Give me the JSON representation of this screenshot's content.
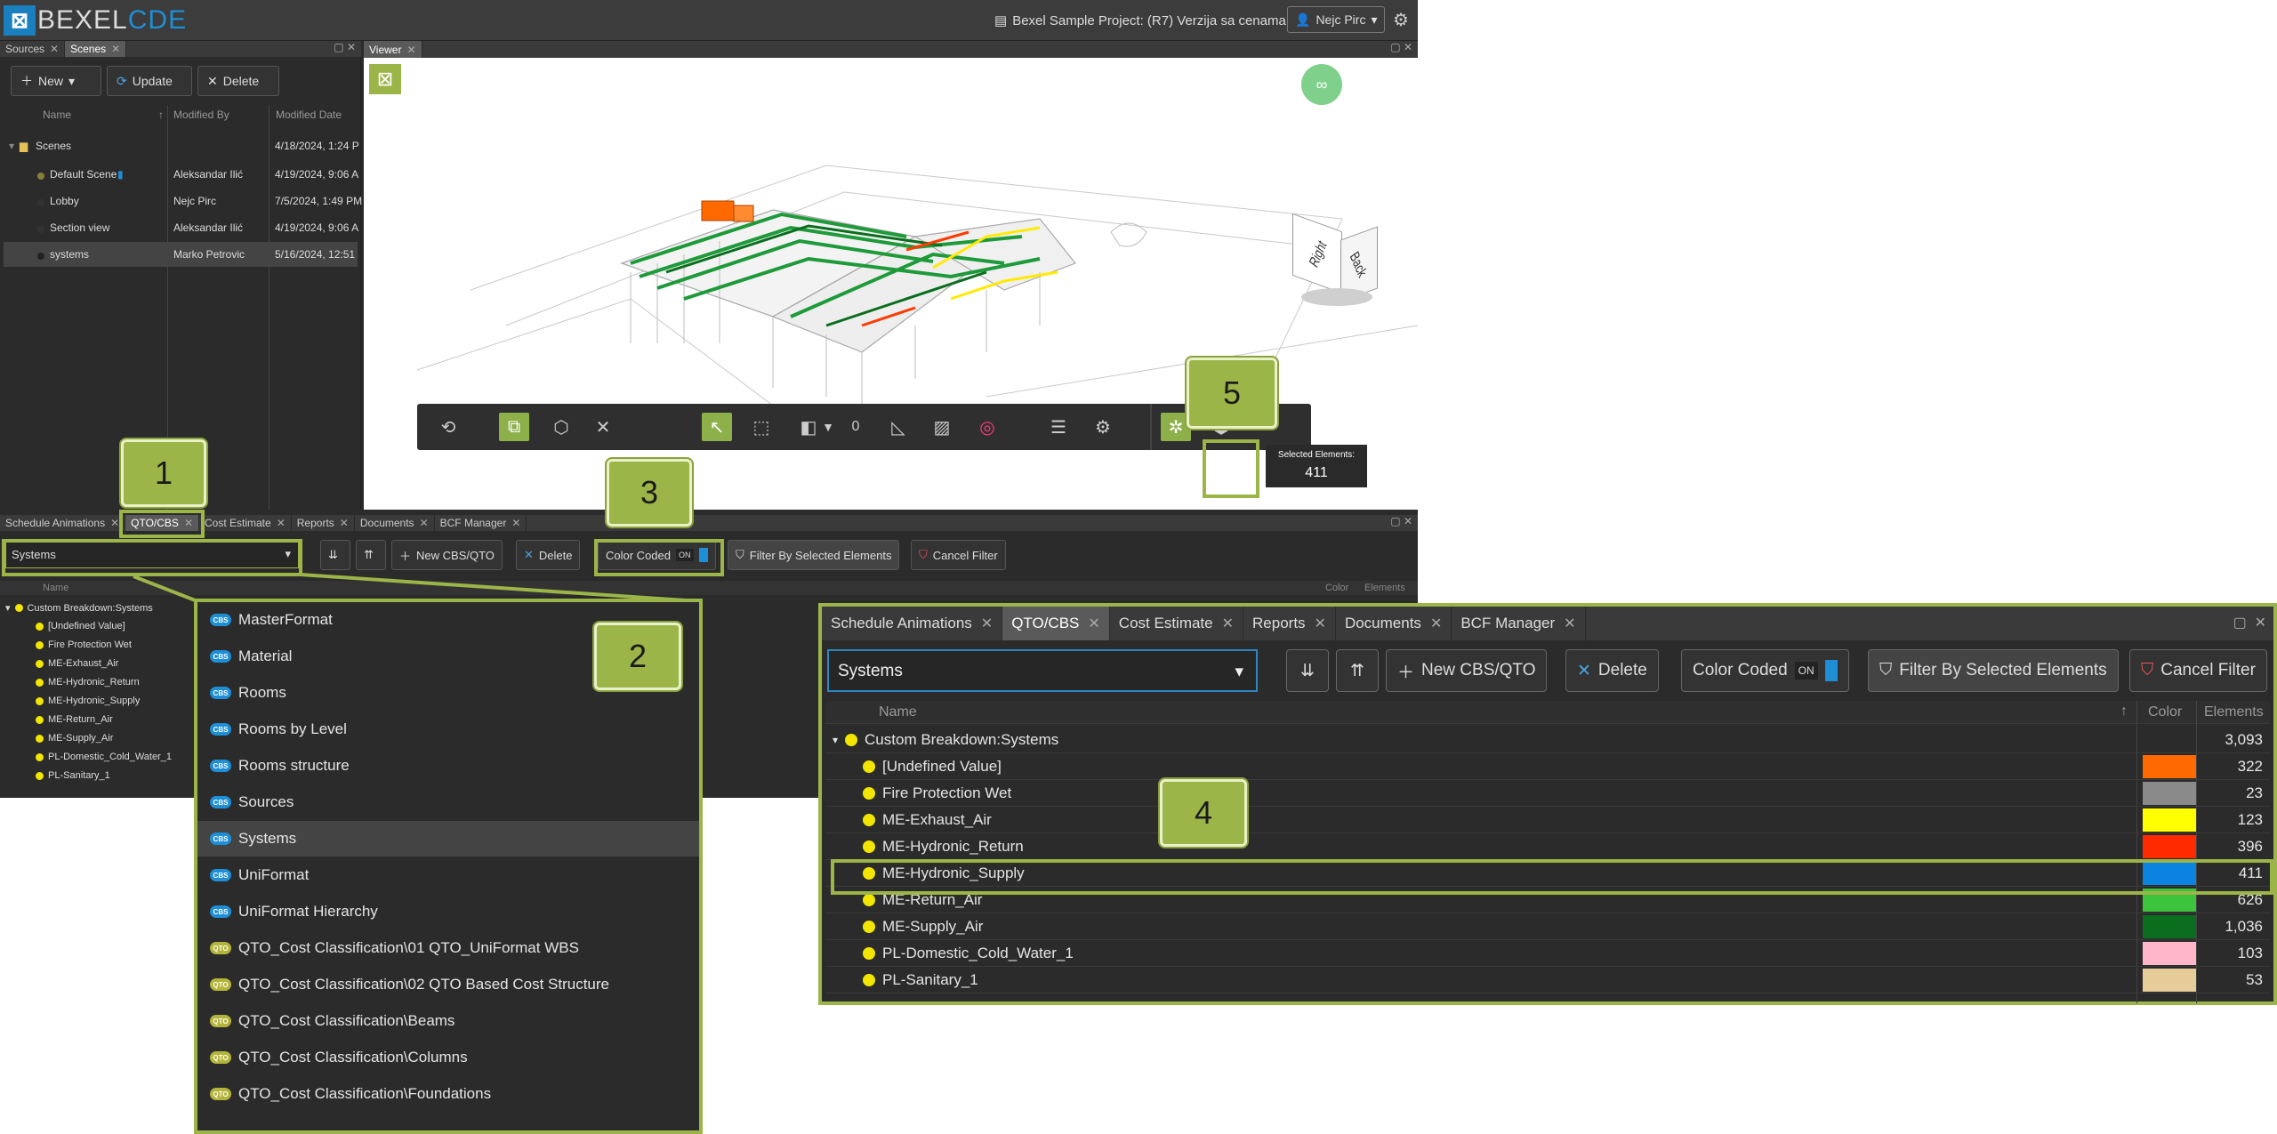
{
  "app": {
    "logo_mark": "⊠",
    "logo_text": "BEXEL",
    "logo_text_accent": "CDE",
    "project_title": "Bexel Sample Project: (R7) Verzija sa cenama",
    "user_name": "Nejc Pirc"
  },
  "scenes_panel": {
    "tabs": [
      {
        "label": "Sources"
      },
      {
        "label": "Scenes"
      }
    ],
    "buttons": {
      "new": "New",
      "update": "Update",
      "delete": "Delete"
    },
    "columns": {
      "name": "Name",
      "modified_by": "Modified By",
      "modified_date": "Modified Date"
    },
    "rows": [
      {
        "name": "Scenes",
        "by": "",
        "date": "4/18/2024, 1:24 P"
      },
      {
        "name": "Default Scene",
        "by": "Aleksandar Ilić",
        "date": "4/19/2024, 9:06 A"
      },
      {
        "name": "Lobby",
        "by": "Nejc Pirc",
        "date": "7/5/2024, 1:49 PM"
      },
      {
        "name": "Section view",
        "by": "Aleksandar Ilić",
        "date": "4/19/2024, 9:06 A"
      },
      {
        "name": "systems",
        "by": "Marko Petrovic",
        "date": "5/16/2024, 12:51"
      }
    ]
  },
  "viewer": {
    "tab_label": "Viewer",
    "counter": "0",
    "selected_label": "Selected Elements:",
    "selected_count": "411",
    "cube_right": "Right",
    "cube_back": "Back"
  },
  "lower_panel": {
    "tabs": [
      {
        "label": "Schedule Animations"
      },
      {
        "label": "QTO/CBS"
      },
      {
        "label": "Cost Estimate"
      },
      {
        "label": "Reports"
      },
      {
        "label": "Documents"
      },
      {
        "label": "BCF Manager"
      }
    ],
    "select_value": "Systems",
    "new_cbs": "New CBS/QTO",
    "delete": "Delete",
    "color_coded": "Color Coded",
    "toggle_on": "ON",
    "filter_selected": "Filter By Selected Elements",
    "cancel_filter": "Cancel Filter",
    "col_name": "Name",
    "col_color": "Color",
    "col_elements": "Elements",
    "root": "Custom Breakdown:Systems",
    "items": [
      "[Undefined Value]",
      "Fire Protection Wet",
      "ME-Exhaust_Air",
      "ME-Hydronic_Return",
      "ME-Hydronic_Supply",
      "ME-Return_Air",
      "ME-Supply_Air",
      "PL-Domestic_Cold_Water_1",
      "PL-Sanitary_1"
    ]
  },
  "dropdown": {
    "items": [
      {
        "label": "MasterFormat",
        "badge": "CBS"
      },
      {
        "label": "Material",
        "badge": "CBS"
      },
      {
        "label": "Rooms",
        "badge": "CBS"
      },
      {
        "label": "Rooms by Level",
        "badge": "CBS"
      },
      {
        "label": "Rooms structure",
        "badge": "CBS"
      },
      {
        "label": "Sources",
        "badge": "CBS"
      },
      {
        "label": "Systems",
        "badge": "CBS"
      },
      {
        "label": "UniFormat",
        "badge": "CBS"
      },
      {
        "label": "UniFormat Hierarchy",
        "badge": "CBS"
      },
      {
        "label": "QTO_Cost Classification\\01 QTO_UniFormat WBS",
        "badge": "QTO"
      },
      {
        "label": "QTO_Cost Classification\\02 QTO Based Cost Structure",
        "badge": "QTO"
      },
      {
        "label": "QTO_Cost Classification\\Beams",
        "badge": "QTO"
      },
      {
        "label": "QTO_Cost Classification\\Columns",
        "badge": "QTO"
      },
      {
        "label": "QTO_Cost Classification\\Foundations",
        "badge": "QTO"
      }
    ]
  },
  "zoom_panel": {
    "root_count": "3,093",
    "rows": [
      {
        "name": "[Undefined Value]",
        "color": "#ff6a00",
        "count": "322"
      },
      {
        "name": "Fire Protection Wet",
        "color": "#8a8a8a",
        "count": "23"
      },
      {
        "name": "ME-Exhaust_Air",
        "color": "#ffff00",
        "count": "123"
      },
      {
        "name": "ME-Hydronic_Return",
        "color": "#ff2a00",
        "count": "396"
      },
      {
        "name": "ME-Hydronic_Supply",
        "color": "#0a84e0",
        "count": "411"
      },
      {
        "name": "ME-Return_Air",
        "color": "#3cc43c",
        "count": "626"
      },
      {
        "name": "ME-Supply_Air",
        "color": "#0a6e1e",
        "count": "1,036"
      },
      {
        "name": "PL-Domestic_Cold_Water_1",
        "color": "#ffb6c8",
        "count": "103"
      },
      {
        "name": "PL-Sanitary_1",
        "color": "#e6cc99",
        "count": "53"
      }
    ]
  },
  "callouts": [
    "1",
    "2",
    "3",
    "4",
    "5"
  ],
  "colors": {
    "accent": "#9cb549",
    "brand": "#1e8fd6"
  }
}
